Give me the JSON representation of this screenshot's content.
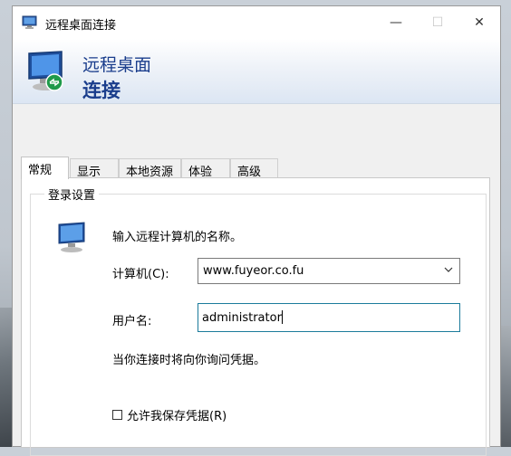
{
  "window": {
    "title": "远程桌面连接",
    "minimize_glyph": "—",
    "maximize_glyph": "☐",
    "close_glyph": "✕"
  },
  "banner": {
    "line1": "远程桌面",
    "line2": "连接"
  },
  "tabs": [
    {
      "label": "常规",
      "active": true
    },
    {
      "label": "显示",
      "active": false
    },
    {
      "label": "本地资源",
      "active": false
    },
    {
      "label": "体验",
      "active": false
    },
    {
      "label": "高级",
      "active": false
    }
  ],
  "login": {
    "group_label": "登录设置",
    "hint": "输入远程计算机的名称。",
    "computer_label": "计算机(C):",
    "computer_value": "www.fuyeor.co.fu",
    "username_label": "用户名:",
    "username_value": "administrator",
    "credentials_note": "当你连接时将向你询问凭据。",
    "save_credentials_label": "允许我保存凭据(R)",
    "save_credentials_checked": false
  },
  "colors": {
    "banner_text": "#1a3d8c",
    "focus_border": "#1b7b9b"
  },
  "icons": [
    "remote-desktop-icon",
    "computer-icon",
    "chevron-down-icon"
  ]
}
